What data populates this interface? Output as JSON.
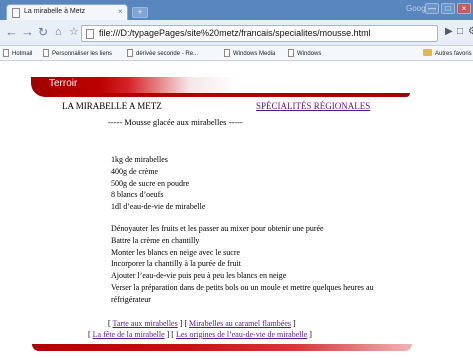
{
  "browser": {
    "tab_title": "La mirabelle à Metz",
    "tab_close": "×",
    "new_tab": "+",
    "brand": "Google",
    "window_controls": {
      "minimize": "—",
      "maximize": "□",
      "close": "×"
    },
    "url": "file:///D:/typagePages/site%20metz/francais/specialites/mousse.html",
    "icons": [
      "back-icon",
      "forward-icon",
      "reload-icon",
      "home-icon",
      "star-icon",
      "page-icon",
      "play-icon",
      "page-menu-icon",
      "wrench-icon"
    ]
  },
  "bookmarks": {
    "items": [
      "Hotmail",
      "Personnaliser les liens",
      "dérivée seconde - Re...",
      "Windows Media",
      "Windows"
    ],
    "other": "Autres favoris"
  },
  "page": {
    "banner": "Terroir",
    "heading_left": "LA MIRABELLE A METZ",
    "heading_right": "SPÉCIALITÉS RÉGIONALES",
    "subtitle": "----- Mousse glacée aux mirabelles -----",
    "ingredients": [
      "1kg de mirabelles",
      "400g de crème",
      "500g de sucre en poudre",
      "8 blancs d’oeufs",
      "1dl d’eau-de-vie de mirabelle"
    ],
    "steps": [
      "Dénoyauter les fruits et les passer au mixer pour obtenir une purée",
      "Battre la crème en chantilly",
      "Monter les blancs en neige avec le sucre",
      "Incorporer la chantilly à la purée de fruit",
      "Ajouter l’eau-de-vie puis peu à peu les blancs en neige",
      "Verser la préparation dans de petits bols ou un moule et mettre quelques heures au",
      "réfrigérateur"
    ],
    "links_row1": {
      "open": "[ ",
      "a": "Tarte aux mirabelles",
      "mid": " ] [ ",
      "b": "Mirabelles au caramel flambées",
      "close": " ]"
    },
    "links_row2": {
      "open": "[ ",
      "a": "La fête de la mirabelle",
      "mid": " ] [ ",
      "b": "Les origines de l’eau-de-vie de mirabelle",
      "close": " ]"
    }
  }
}
